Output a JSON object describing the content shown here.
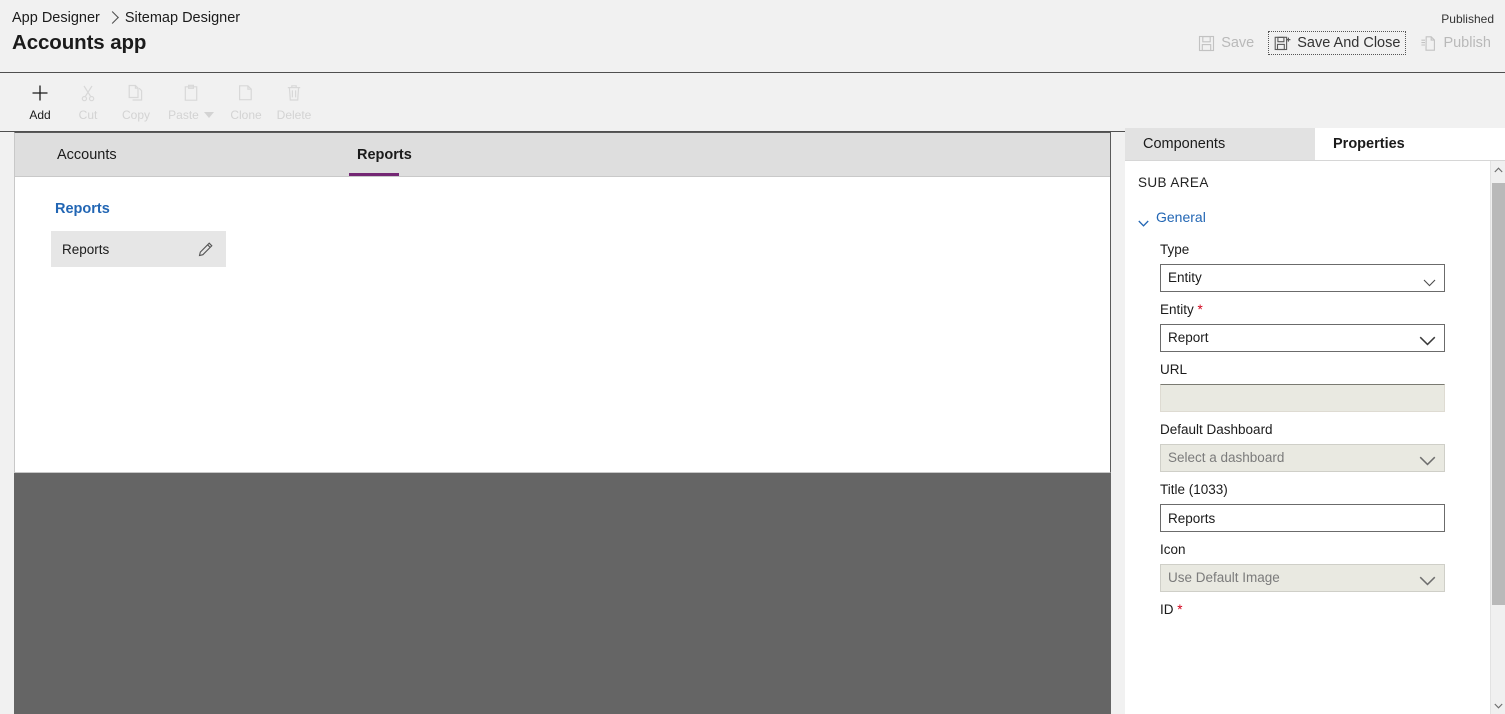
{
  "header": {
    "breadcrumb": {
      "parent": "App Designer",
      "current": "Sitemap Designer"
    },
    "app_title": "Accounts app",
    "published_status": "Published",
    "actions": [
      {
        "label": "Save",
        "icon": "save-icon",
        "enabled": false,
        "focused": false
      },
      {
        "label": "Save And Close",
        "icon": "save-and-close-icon",
        "enabled": true,
        "focused": true
      },
      {
        "label": "Publish",
        "icon": "publish-icon",
        "enabled": false,
        "focused": false
      }
    ]
  },
  "toolbar": {
    "items": [
      {
        "label": "Add",
        "icon": "plus-icon",
        "enabled": true,
        "caret": false
      },
      {
        "label": "Cut",
        "icon": "scissors-icon",
        "enabled": false,
        "caret": false
      },
      {
        "label": "Copy",
        "icon": "copy-icon",
        "enabled": false,
        "caret": false
      },
      {
        "label": "Paste",
        "icon": "clipboard-icon",
        "enabled": false,
        "caret": true
      },
      {
        "label": "Clone",
        "icon": "clone-icon",
        "enabled": false,
        "caret": false
      },
      {
        "label": "Delete",
        "icon": "trash-icon",
        "enabled": false,
        "caret": false
      }
    ]
  },
  "canvas": {
    "tabs": [
      {
        "label": "Accounts",
        "active": false
      },
      {
        "label": "Reports",
        "active": true
      }
    ],
    "group_title": "Reports",
    "subarea": {
      "label": "Reports",
      "edit_icon": "pencil-icon"
    },
    "accent_color": "#742774",
    "link_color": "#2266b4"
  },
  "properties_panel": {
    "tabs": [
      {
        "label": "Components",
        "active": false
      },
      {
        "label": "Properties",
        "active": true
      }
    ],
    "section_caption": "SUB AREA",
    "section_toggle": {
      "label": "General",
      "expanded": true
    },
    "fields": [
      {
        "label": "Type",
        "required": false,
        "control": "select",
        "value": "Entity",
        "placeholder": "",
        "enabled": true,
        "chevron": "thin"
      },
      {
        "label": "Entity",
        "required": true,
        "control": "select",
        "value": "Report",
        "placeholder": "",
        "enabled": true,
        "chevron": "thick"
      },
      {
        "label": "URL",
        "required": false,
        "control": "text",
        "value": "",
        "placeholder": "",
        "enabled": false,
        "chevron": ""
      },
      {
        "label": "Default Dashboard",
        "required": false,
        "control": "select",
        "value": "",
        "placeholder": "Select a dashboard",
        "enabled": false,
        "chevron": "thick"
      },
      {
        "label": "Title (1033)",
        "required": false,
        "control": "text",
        "value": "Reports",
        "placeholder": "",
        "enabled": true,
        "chevron": ""
      },
      {
        "label": "Icon",
        "required": false,
        "control": "select",
        "value": "",
        "placeholder": "Use Default Image",
        "enabled": false,
        "chevron": "thick"
      },
      {
        "label": "ID",
        "required": true,
        "control": "text",
        "value": "",
        "placeholder": "",
        "enabled": true,
        "chevron": ""
      }
    ],
    "required_marker": "*"
  }
}
